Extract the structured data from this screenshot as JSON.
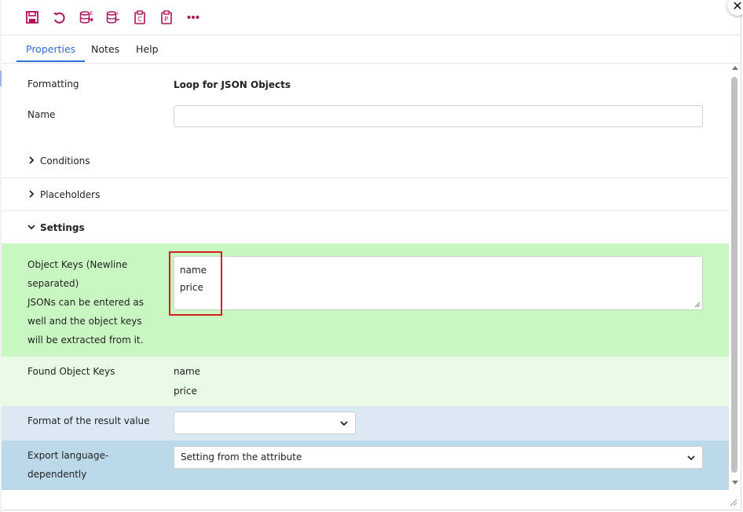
{
  "colors": {
    "accent": "#b0135a",
    "tab_active": "#2f6fd6",
    "settings_row_bg": "#c9f7c2",
    "found_keys_bg": "#e8fbe5",
    "format_row_bg": "#dbe9f3",
    "export_row_bg": "#bcd9ea",
    "highlight": "#d32020"
  },
  "toolbar": {
    "buttons": [
      {
        "icon": "save-icon"
      },
      {
        "icon": "undo-icon"
      },
      {
        "icon": "database-export-icon"
      },
      {
        "icon": "database-import-icon"
      },
      {
        "icon": "clipboard-c-icon"
      },
      {
        "icon": "clipboard-p-icon"
      },
      {
        "icon": "more-icon"
      }
    ]
  },
  "tabs": [
    {
      "label": "Properties",
      "active": true
    },
    {
      "label": "Notes",
      "active": false
    },
    {
      "label": "Help",
      "active": false
    }
  ],
  "form": {
    "formatting_label": "Formatting",
    "formatting_value": "Loop for JSON Objects",
    "name_label": "Name",
    "name_value": "",
    "sections": {
      "conditions": "Conditions",
      "placeholders": "Placeholders",
      "settings": "Settings"
    },
    "object_keys_label": "Object Keys (Newline separated)",
    "object_keys_hint": "JSONs can be entered as well and the object keys will be extracted from it.",
    "object_keys_value": [
      "name",
      "price"
    ],
    "found_keys_label": "Found Object Keys",
    "found_keys": [
      "name",
      "price"
    ],
    "format_label": "Format of the result value",
    "format_value": "",
    "export_label": "Export language-dependently",
    "export_value": "Setting from the attribute"
  }
}
